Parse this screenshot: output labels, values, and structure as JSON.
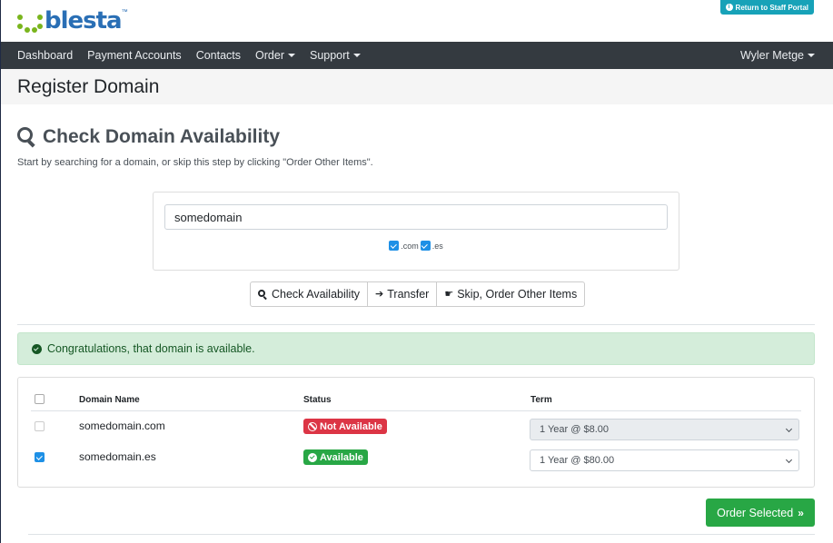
{
  "brand": {
    "logo_text": "blesta",
    "logo_tm": "™",
    "logo_color": "#2a6fb5",
    "dots_color": "#7ab51d"
  },
  "staff_portal": {
    "label": "Return to Staff Portal",
    "icon": "info-icon"
  },
  "nav": {
    "items": [
      {
        "label": "Dashboard",
        "dropdown": false
      },
      {
        "label": "Payment Accounts",
        "dropdown": false
      },
      {
        "label": "Contacts",
        "dropdown": false
      },
      {
        "label": "Order",
        "dropdown": true
      },
      {
        "label": "Support",
        "dropdown": true
      }
    ],
    "user": "Wyler Metge"
  },
  "page_title": "Register Domain",
  "section": {
    "title": "Check Domain Availability",
    "icon": "search-icon",
    "subtitle": "Start by searching for a domain, or skip this step by clicking \"Order Other Items\"."
  },
  "search": {
    "value": "somedomain",
    "tlds": [
      {
        "label": ".com",
        "checked": true
      },
      {
        "label": ".es",
        "checked": true
      }
    ]
  },
  "actions": {
    "check": "Check Availability",
    "transfer": "Transfer",
    "skip": "Skip, Order Other Items"
  },
  "alert": {
    "message": "Congratulations, that domain is available.",
    "color": "#d4edda"
  },
  "table": {
    "headers": {
      "domain": "Domain Name",
      "status": "Status",
      "term": "Term"
    },
    "rows": [
      {
        "checked": false,
        "domain": "somedomain.com",
        "status": "Not Available",
        "status_color": "#dc3545",
        "term": "1 Year @ $8.00",
        "disabled": true
      },
      {
        "checked": true,
        "domain": "somedomain.es",
        "status": "Available",
        "status_color": "#28a745",
        "term": "1 Year @ $80.00",
        "disabled": false
      }
    ]
  },
  "order_button": {
    "label": "Order Selected",
    "icon": "double-chevron-right-icon",
    "color": "#28a745"
  }
}
